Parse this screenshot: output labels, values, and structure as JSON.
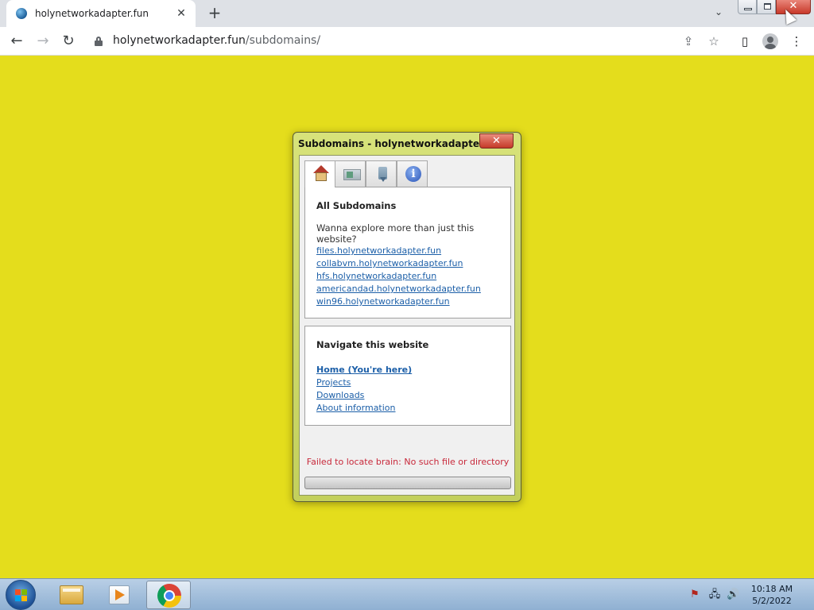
{
  "browser": {
    "tab": {
      "title": "holynetworkadapter.fun",
      "close_glyph": "✕"
    },
    "new_tab_glyph": "+",
    "tab_search_glyph": "⌄",
    "address": {
      "domain": "holynetworkadapter.fun",
      "path": "/subdomains/"
    },
    "nav": {
      "back_glyph": "←",
      "forward_glyph": "→",
      "reload_glyph": "↻"
    },
    "toolbar_icons": {
      "share": "⇪",
      "star": "☆",
      "sidepanel": "▯",
      "menu": "⋮"
    },
    "window_close_glyph": "✕"
  },
  "dialog": {
    "title": "Subdomains - holynetworkadapter.fun",
    "close_glyph": "✕",
    "tabs": [
      {
        "icon": "home-icon"
      },
      {
        "icon": "monitor-icon"
      },
      {
        "icon": "usb-drive-icon"
      },
      {
        "icon": "info-icon",
        "glyph": "i"
      }
    ],
    "subdomains": {
      "heading": "All Subdomains",
      "text": "Wanna explore more than just this website?",
      "links": [
        "files.holynetworkadapter.fun",
        "collabvm.holynetworkadapter.fun",
        "hfs.holynetworkadapter.fun",
        "americandad.holynetworkadapter.fun",
        "win96.holynetworkadapter.fun"
      ]
    },
    "navigation": {
      "heading": "Navigate this website",
      "links": [
        "Home (You're here)",
        "Projects",
        "Downloads",
        "About information"
      ]
    },
    "error": "Failed to locate brain: No such file or directory"
  },
  "taskbar": {
    "tray_icons": {
      "flag": "⚑",
      "network": "🖧",
      "volume": "🔊"
    },
    "time": "10:18 AM",
    "date": "5/2/2022"
  },
  "colors": {
    "page_background": "#e4dd1c",
    "link": "#1c5fa8",
    "error": "#c8283a"
  }
}
